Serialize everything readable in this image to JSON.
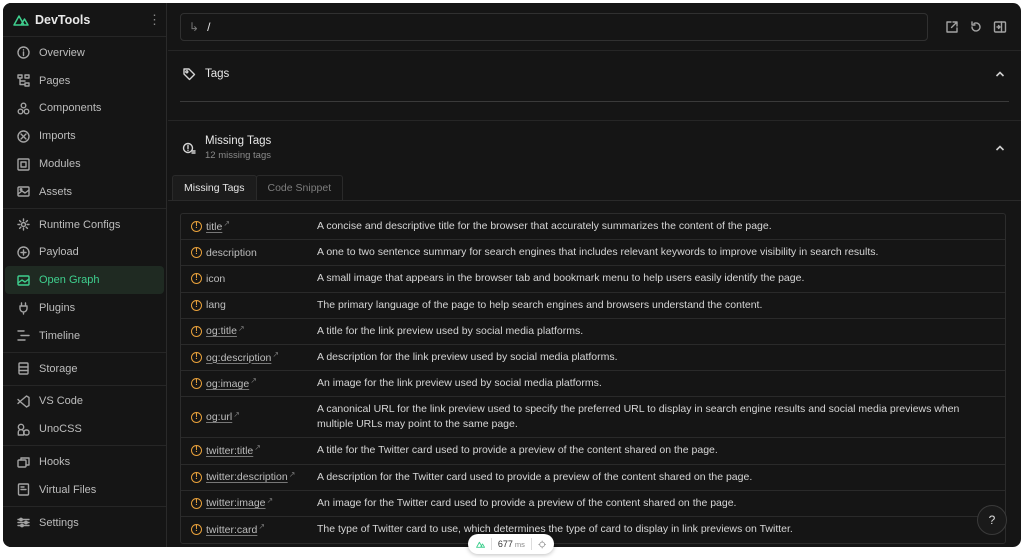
{
  "app": {
    "name": "DevTools",
    "accent": "#3fcf8e",
    "warning": "#e8a13b"
  },
  "sidebar": {
    "groups": [
      [
        {
          "label": "Overview",
          "icon": "info-icon"
        },
        {
          "label": "Pages",
          "icon": "pages-icon"
        },
        {
          "label": "Components",
          "icon": "components-icon"
        },
        {
          "label": "Imports",
          "icon": "imports-icon"
        },
        {
          "label": "Modules",
          "icon": "modules-icon"
        },
        {
          "label": "Assets",
          "icon": "assets-icon"
        }
      ],
      [
        {
          "label": "Runtime Configs",
          "icon": "gear-icon"
        },
        {
          "label": "Payload",
          "icon": "payload-icon"
        },
        {
          "label": "Open Graph",
          "icon": "open-graph-icon",
          "active": true
        },
        {
          "label": "Plugins",
          "icon": "plug-icon"
        },
        {
          "label": "Timeline",
          "icon": "timeline-icon"
        }
      ],
      [
        {
          "label": "Storage",
          "icon": "storage-icon"
        }
      ],
      [
        {
          "label": "VS Code",
          "icon": "vscode-icon"
        },
        {
          "label": "UnoCSS",
          "icon": "unocss-icon"
        }
      ],
      [
        {
          "label": "Hooks",
          "icon": "hooks-icon"
        },
        {
          "label": "Virtual Files",
          "icon": "virtual-files-icon"
        }
      ],
      [
        {
          "label": "Settings",
          "icon": "settings-icon"
        }
      ]
    ]
  },
  "topbar": {
    "route": "/"
  },
  "tags_section": {
    "title": "Tags"
  },
  "missing_section": {
    "title": "Missing Tags",
    "subtitle": "12 missing tags"
  },
  "tabs": [
    {
      "label": "Missing Tags",
      "active": true
    },
    {
      "label": "Code Snippet",
      "active": false
    }
  ],
  "missing_tags": [
    {
      "tag": "title",
      "link": true,
      "desc": "A concise and descriptive title for the browser that accurately summarizes the content of the page."
    },
    {
      "tag": "description",
      "link": false,
      "desc": "A one to two sentence summary for search engines that includes relevant keywords to improve visibility in search results."
    },
    {
      "tag": "icon",
      "link": false,
      "desc": "A small image that appears in the browser tab and bookmark menu to help users easily identify the page."
    },
    {
      "tag": "lang",
      "link": false,
      "desc": "The primary language of the page to help search engines and browsers understand the content."
    },
    {
      "tag": "og:title",
      "link": true,
      "desc": "A title for the link preview used by social media platforms."
    },
    {
      "tag": "og:description",
      "link": true,
      "desc": "A description for the link preview used by social media platforms."
    },
    {
      "tag": "og:image",
      "link": true,
      "desc": "An image for the link preview used by social media platforms."
    },
    {
      "tag": "og:url",
      "link": true,
      "tall": true,
      "desc": "A canonical URL for the link preview used to specify the preferred URL to display in search engine results and social media previews when multiple URLs may point to the same page."
    },
    {
      "tag": "twitter:title",
      "link": true,
      "desc": "A title for the Twitter card used to provide a preview of the content shared on the page."
    },
    {
      "tag": "twitter:description",
      "link": true,
      "desc": "A description for the Twitter card used to provide a preview of the content shared on the page."
    },
    {
      "tag": "twitter:image",
      "link": true,
      "desc": "An image for the Twitter card used to provide a preview of the content shared on the page."
    },
    {
      "tag": "twitter:card",
      "link": true,
      "desc": "The type of Twitter card to use, which determines the type of card to display in link previews on Twitter."
    }
  ],
  "help": {
    "label": "?"
  },
  "perf": {
    "value": "677",
    "unit": "ms"
  }
}
